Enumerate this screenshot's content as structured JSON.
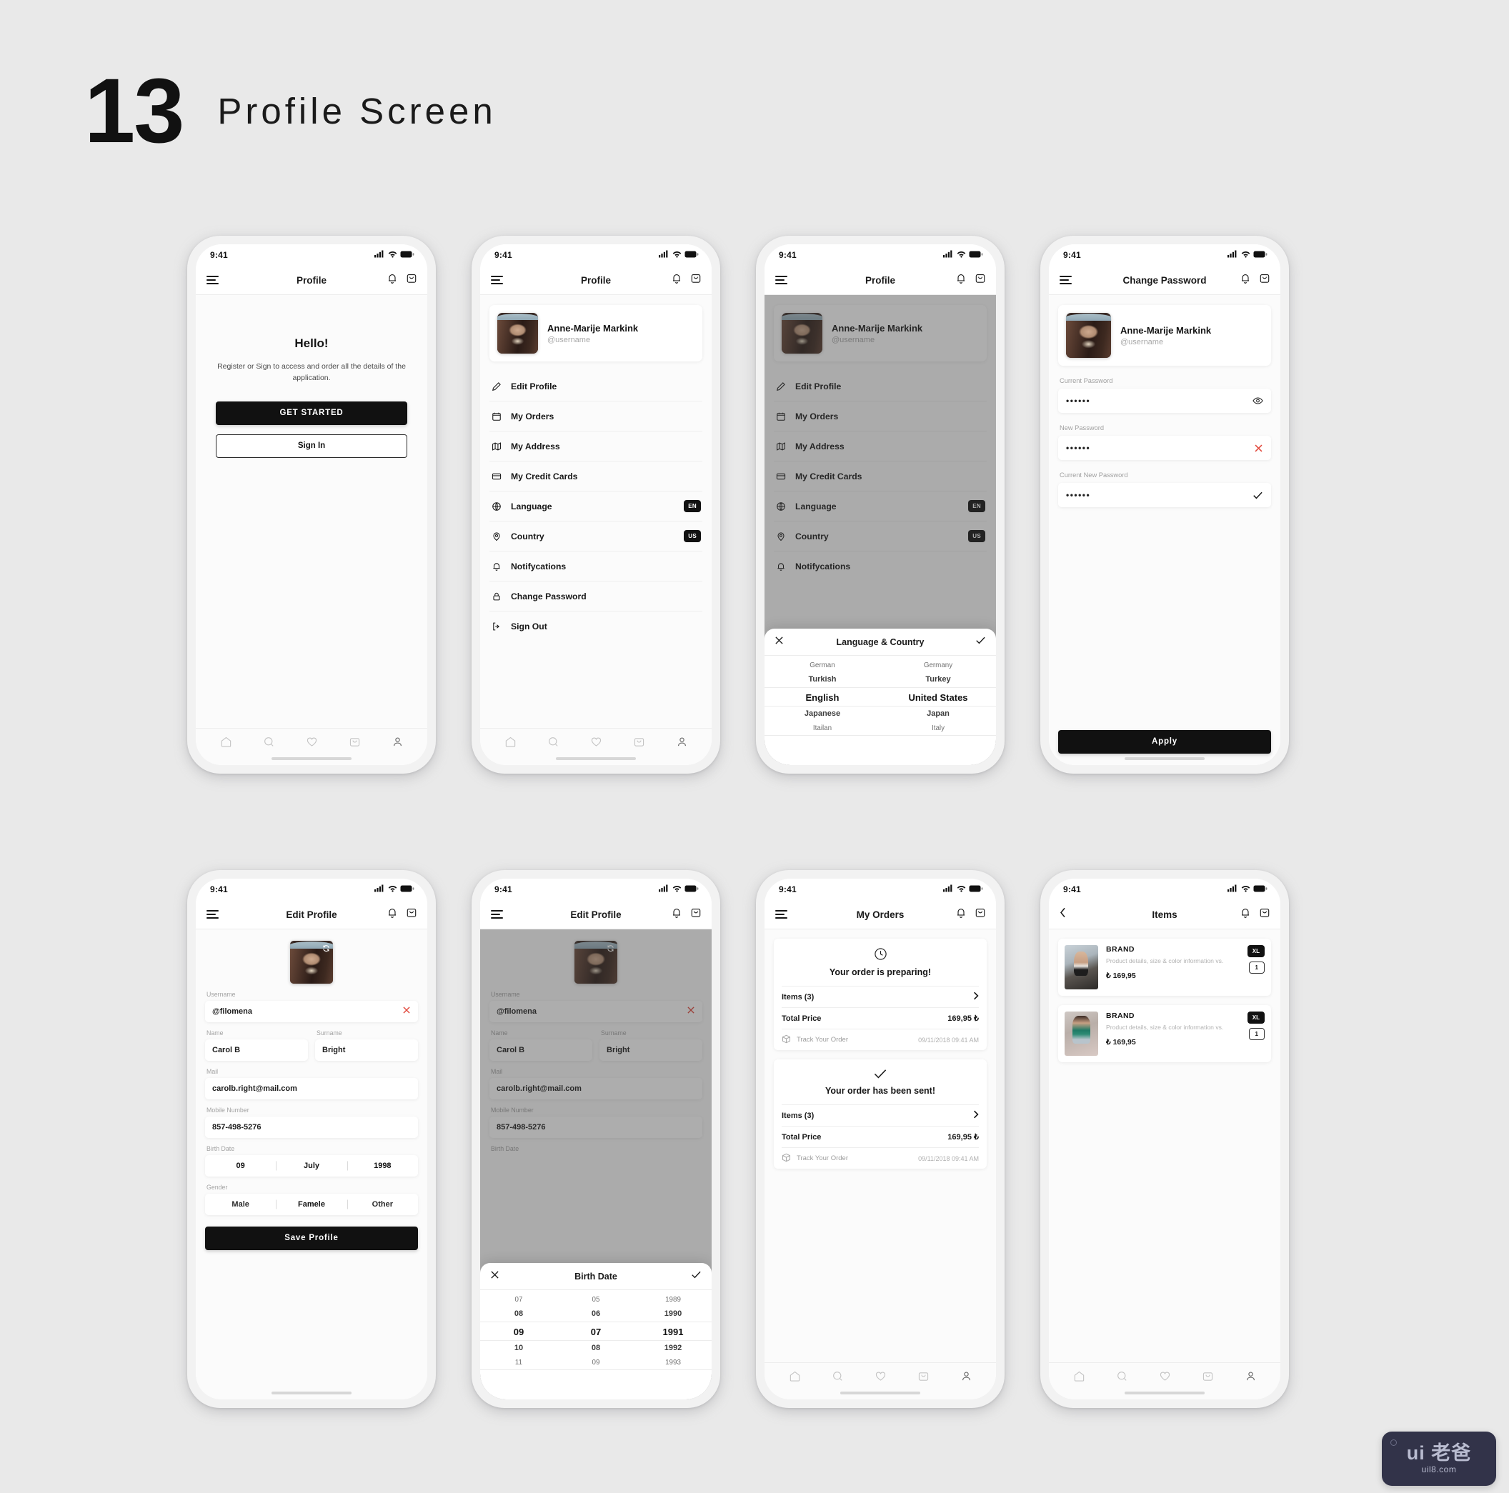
{
  "header": {
    "number": "13",
    "title": "Profile Screen"
  },
  "statusbar": {
    "time": "9:41",
    "icons": [
      "signal-icon",
      "wifi-icon",
      "battery-icon"
    ]
  },
  "nav_icons": {
    "menu": "hamburger-icon",
    "bell": "bell-icon",
    "bag": "shopping-bag-icon",
    "back": "chevron-left-icon"
  },
  "tabbar": {
    "items": [
      "home-icon",
      "search-icon",
      "heart-icon",
      "bag-icon",
      "person-icon"
    ]
  },
  "user": {
    "name": "Anne-Marije Markink",
    "handle": "@username"
  },
  "screen1": {
    "nav_title": "Profile",
    "hello_title": "Hello!",
    "hello_sub": "Register or Sign to access and order all the details of the application.",
    "primary_button": "GET STARTED",
    "secondary_button": "Sign In"
  },
  "screen2": {
    "nav_title": "Profile",
    "menu": [
      {
        "label": "Edit Profile",
        "icon": "pencil-icon",
        "badge": ""
      },
      {
        "label": "My Orders",
        "icon": "calendar-icon",
        "badge": ""
      },
      {
        "label": "My Address",
        "icon": "map-icon",
        "badge": ""
      },
      {
        "label": "My Credit Cards",
        "icon": "card-icon",
        "badge": ""
      },
      {
        "label": "Language",
        "icon": "globe-icon",
        "badge": "EN"
      },
      {
        "label": "Country",
        "icon": "pin-icon",
        "badge": "US"
      },
      {
        "label": "Notifycations",
        "icon": "bell-icon",
        "badge": ""
      },
      {
        "label": "Change Password",
        "icon": "lock-icon",
        "badge": ""
      },
      {
        "label": "Sign Out",
        "icon": "logout-icon",
        "badge": ""
      }
    ]
  },
  "screen3": {
    "nav_title": "Profile",
    "sheet_title": "Language & Country",
    "close_icon": "close-icon",
    "confirm_icon": "check-icon",
    "languages": [
      "German",
      "Turkish",
      "English",
      "Japanese",
      "Itailan"
    ],
    "countries": [
      "Germany",
      "Turkey",
      "United States",
      "Japan",
      "Italy"
    ],
    "selected_language": "English",
    "selected_country": "United States"
  },
  "screen4": {
    "nav_title": "Change Password",
    "fields": [
      {
        "label": "Current Password",
        "value": "••••••",
        "action": "eye-icon"
      },
      {
        "label": "New Password",
        "value": "••••••",
        "action": "error-x-icon"
      },
      {
        "label": "Current New Password",
        "value": "••••••",
        "action": "check-icon"
      }
    ],
    "apply_button": "Apply"
  },
  "screen5": {
    "nav_title": "Edit Profile",
    "avatar_action": "refresh-icon",
    "username": {
      "label": "Username",
      "value": "@filomena",
      "action": "clear-x-icon"
    },
    "name": {
      "label": "Name",
      "value": "Carol B"
    },
    "surname": {
      "label": "Surname",
      "value": "Bright"
    },
    "mail": {
      "label": "Mail",
      "value": "carolb.right@mail.com"
    },
    "mobile": {
      "label": "Mobile Number",
      "value": "857-498-5276"
    },
    "birth": {
      "label": "Birth Date",
      "day": "09",
      "month": "July",
      "year": "1998"
    },
    "gender": {
      "label": "Gender",
      "options": [
        "Male",
        "Famele",
        "Other"
      ],
      "selected": "Famele"
    },
    "save_button": "Save Profile"
  },
  "screen6": {
    "nav_title": "Edit Profile",
    "sheet_title": "Birth Date",
    "close_icon": "close-icon",
    "confirm_icon": "check-icon",
    "days": [
      "07",
      "08",
      "09",
      "10",
      "11"
    ],
    "months": [
      "05",
      "06",
      "07",
      "08",
      "09"
    ],
    "years": [
      "1989",
      "1990",
      "1991",
      "1992",
      "1993"
    ],
    "selected": {
      "day": "09",
      "month": "07",
      "year": "1991"
    }
  },
  "screen7": {
    "nav_title": "My Orders",
    "orders": [
      {
        "status": "Your order is preparing!",
        "status_icon": "clock-icon",
        "items_label": "Items (3)",
        "chevron": "chevron-right-icon",
        "total_label": "Total Price",
        "total_value": "169,95 ₺",
        "track_icon": "package-icon",
        "track_label": "Track Your Order",
        "track_date": "09/11/2018 09:41 AM"
      },
      {
        "status": "Your order has been sent!",
        "status_icon": "check-icon",
        "items_label": "Items (3)",
        "chevron": "chevron-right-icon",
        "total_label": "Total Price",
        "total_value": "169,95 ₺",
        "track_icon": "package-icon",
        "track_label": "Track Your Order",
        "track_date": "09/11/2018 09:41 AM"
      }
    ]
  },
  "screen8": {
    "nav_title": "Items",
    "items": [
      {
        "brand": "BRAND",
        "desc": "Product details, size & color information vs.",
        "price": "₺ 169,95",
        "size": "XL",
        "qty": "1"
      },
      {
        "brand": "BRAND",
        "desc": "Product details, size & color information vs.",
        "price": "₺ 169,95",
        "size": "XL",
        "qty": "1"
      }
    ]
  },
  "watermark": {
    "top": "ui 老爸",
    "bottom": "uil8.com"
  }
}
